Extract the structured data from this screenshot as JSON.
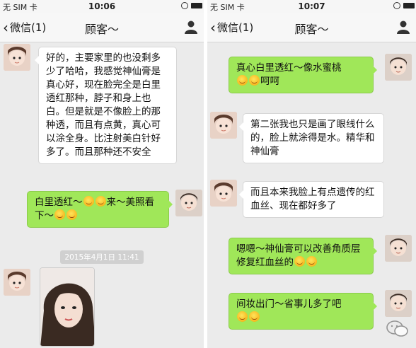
{
  "left": {
    "status": {
      "carrier": "无 SIM 卡",
      "time": "10:06"
    },
    "nav": {
      "back_label": "微信(1)",
      "title": "顾客～"
    },
    "messages": [
      {
        "side": "received",
        "text": "好的，主要家里的也没剩多少了哈哈，我感觉神仙膏是真心好，现在脸完全是白里透红那种，脖子和身上也白。但是就是不像脸上的那种透，而且有点黄，真心可以涂全身。比注射美白针好多了。而且那种还不安全"
      },
      {
        "side": "sent",
        "text_a": "白里透红～",
        "text_b": "来～美照看下～"
      },
      {
        "side": "received",
        "type": "image"
      }
    ],
    "timestamp": "2015年4月1日 11:41"
  },
  "right": {
    "status": {
      "carrier": "无 SIM 卡",
      "time": "10:07"
    },
    "nav": {
      "back_label": "微信(1)",
      "title": "顾客～"
    },
    "messages": [
      {
        "side": "sent",
        "text_a": "真心白里透红～像水蜜桃",
        "text_b": "呵呵"
      },
      {
        "side": "received",
        "text": "第二张我也只是画了眼线什么的，脸上就涂得是水。精华和神仙膏"
      },
      {
        "side": "received",
        "text": "而且本来我脸上有点遗传的红血丝、现在都好多了"
      },
      {
        "side": "sent",
        "text": "嗯嗯～神仙膏可以改善角质层修复红血丝的"
      },
      {
        "side": "sent",
        "text": "间妆出门～省事儿多了吧"
      }
    ]
  },
  "emoji_icon": "smiley-emoji",
  "colors": {
    "sent_bubble": "#a0e759",
    "received_bubble": "#ffffff",
    "chat_bg": "#ebebeb"
  }
}
